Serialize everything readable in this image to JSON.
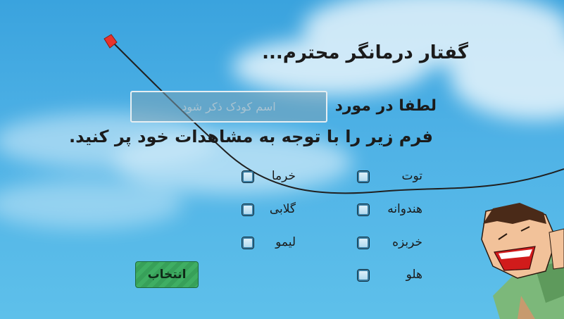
{
  "header": {
    "title": "گفتار درمانگر محترم..."
  },
  "form": {
    "regard_label": "لطفا در مورد",
    "name_placeholder": "اسم کودک ذکر شود",
    "instruction": "فرم زیر را با توجه به مشاهدات خود پر کنید."
  },
  "options": {
    "left": [
      "خرما",
      "گلابی",
      "لیمو"
    ],
    "right": [
      "توت",
      "هندوانه",
      "خربزه",
      "هلو"
    ]
  },
  "buttons": {
    "select_label": "انتخاب"
  },
  "colors": {
    "sky": "#4fb2e6",
    "kite": "#e8332b",
    "button": "#3fae63",
    "shirt": "#7cb87a"
  }
}
